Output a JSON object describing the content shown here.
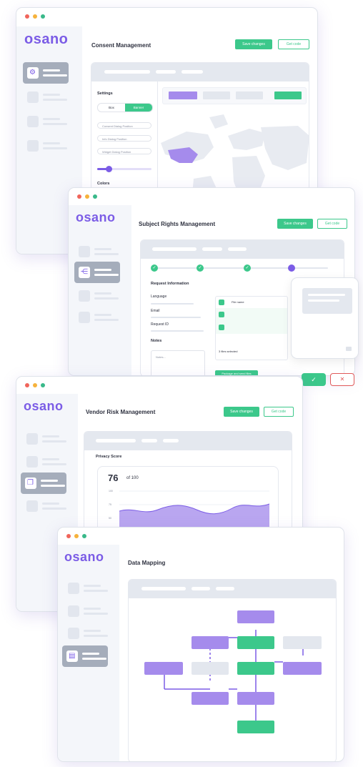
{
  "brand": {
    "logo": "osano",
    "accent": "#7b5ce6",
    "green": "#3cc88b"
  },
  "windows": {
    "consent": {
      "title": "Consent Management",
      "save_label": "Save changes",
      "code_label": "Get code",
      "settings_label": "Settings",
      "toggle": [
        "Box",
        "Banner"
      ],
      "dropdowns": [
        "Consent Dialog Position",
        "Info Dialog Position",
        "Widget Dialog Position"
      ],
      "colors_label": "Colors",
      "slider_level": 0.22
    },
    "dsar": {
      "title": "Subject Rights Management",
      "save_label": "Save changes",
      "code_label": "Get code",
      "request_info_label": "Request Information",
      "fields": [
        "Language",
        "Email",
        "Request ID"
      ],
      "notes_label": "Notes",
      "notes_placeholder": "Notes...",
      "file_header": "File name",
      "files_selected": "3 files selected",
      "package_button": "Package and send files",
      "approve_icon": "✓",
      "reject_icon": "✕",
      "step_icon": "✓"
    },
    "vendor": {
      "title": "Vendor Risk Management",
      "save_label": "Save changes",
      "code_label": "Get code",
      "score_label": "Privacy Score",
      "score_value": "76",
      "score_suffix": "of 100",
      "axis_ticks": [
        "100",
        "75",
        "50"
      ]
    },
    "mapping": {
      "title": "Data Mapping"
    }
  }
}
